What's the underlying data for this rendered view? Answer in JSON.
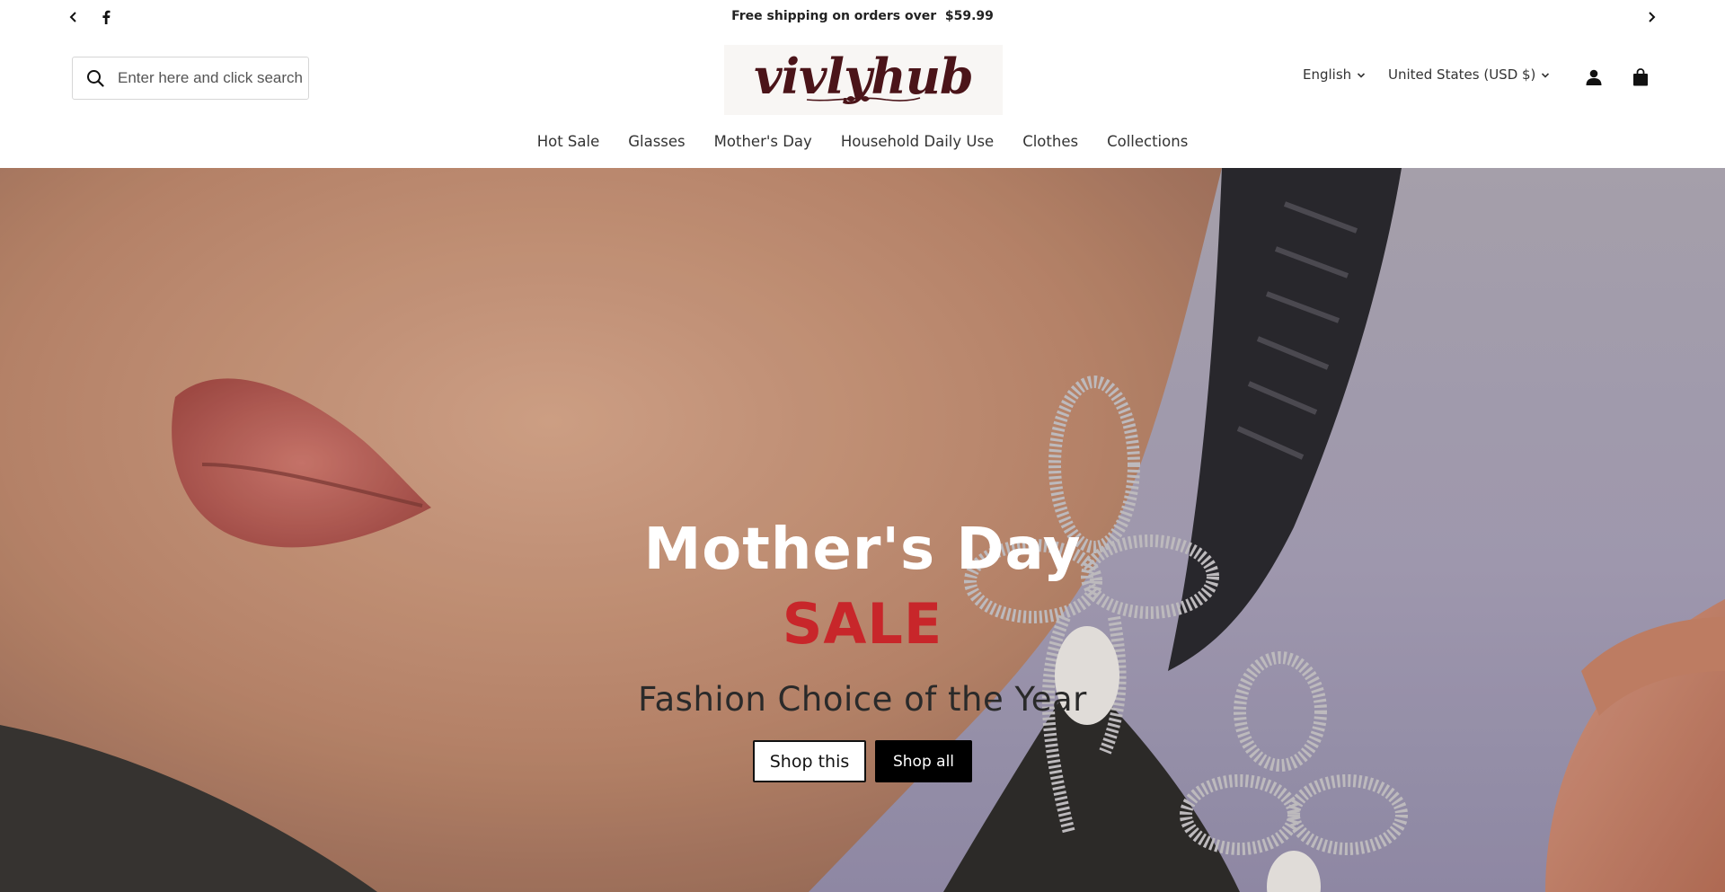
{
  "announcement": {
    "message": "Free shipping on orders over  $59.99",
    "prev_icon": "chevron-left-icon",
    "next_icon": "chevron-right-icon",
    "social_icon": "facebook-icon"
  },
  "header": {
    "search": {
      "placeholder": "Enter here and click search",
      "icon": "search-icon"
    },
    "logo_text": "vivlyhub",
    "language": {
      "selected": "English",
      "icon": "chevron-down-icon"
    },
    "country": {
      "selected": "United States (USD $)",
      "icon": "chevron-down-icon"
    },
    "account_icon": "user-icon",
    "cart_icon": "shopping-bag-icon"
  },
  "nav": {
    "items": [
      {
        "label": "Hot Sale"
      },
      {
        "label": "Glasses"
      },
      {
        "label": "Mother's Day"
      },
      {
        "label": "Household Daily Use"
      },
      {
        "label": "Clothes"
      },
      {
        "label": "Collections"
      }
    ]
  },
  "hero": {
    "title": "Mother's Day",
    "highlight": "SALE",
    "tagline": "Fashion Choice of the Year",
    "buttons": {
      "shop_this": "Shop this",
      "shop_all": "Shop all"
    }
  },
  "colors": {
    "logo": "#4b1419",
    "sale": "#c8262a",
    "hero_bg": "#a8a1b8"
  }
}
